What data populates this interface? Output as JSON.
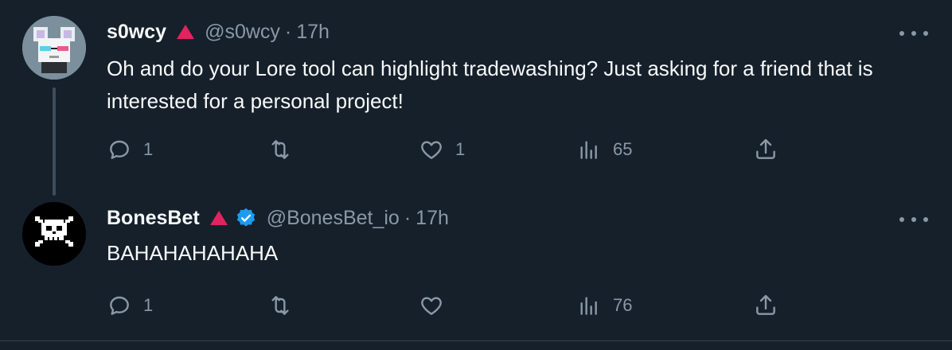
{
  "tweets": [
    {
      "name": "s0wcy",
      "handle": "@s0wcy",
      "separator": "·",
      "time": "17h",
      "text": "Oh and do your Lore tool can highlight tradewashing? Just asking for a friend that is interested for a personal project!",
      "replies": "1",
      "retweets": "",
      "likes": "1",
      "views": "65",
      "avatar_icon": "pixel-art-mouse-avatar-icon"
    },
    {
      "name": "BonesBet",
      "handle": "@BonesBet_io",
      "separator": "·",
      "time": "17h",
      "text": "BAHAHAHAHAHA",
      "replies": "1",
      "retweets": "",
      "likes": "",
      "views": "76",
      "avatar_icon": "pixel-skull-avatar-icon",
      "verified": true
    }
  ],
  "colors": {
    "background": "#15202b",
    "text": "#f7f9f9",
    "muted": "#8b98a5",
    "flag": "#e0245e",
    "verified": "#1d9bf0"
  }
}
